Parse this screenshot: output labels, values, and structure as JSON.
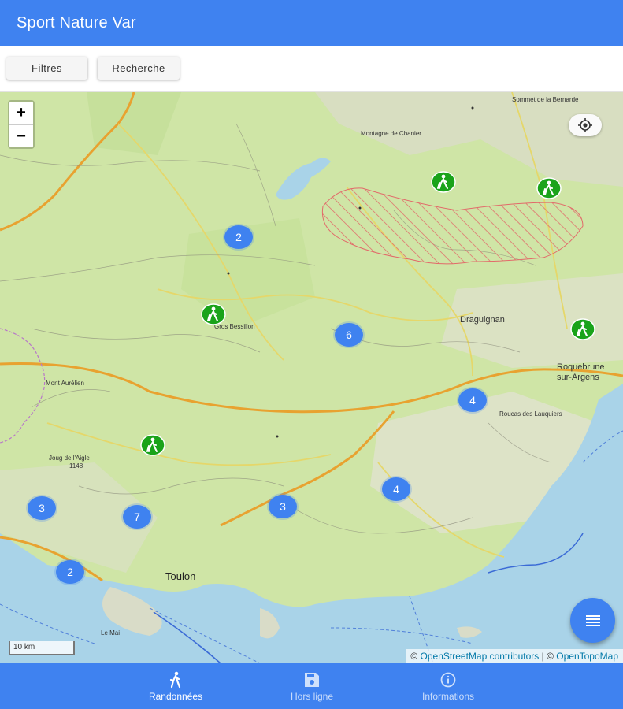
{
  "app": {
    "title": "Sport Nature Var"
  },
  "toolbar": {
    "filters_label": "Filtres",
    "search_label": "Recherche"
  },
  "map": {
    "zoom_in_label": "+",
    "zoom_out_label": "−",
    "scale_label": "10 km",
    "attribution": {
      "prefix": "© ",
      "osm": "OpenStreetMap contributors",
      "separator": " | © ",
      "topo": "OpenTopoMap"
    },
    "place_labels": {
      "draguignan": "Draguignan",
      "roquebrune_1": "Roquebrune",
      "roquebrune_2": "sur-Argens",
      "toulon": "Toulon",
      "gros_bessillon": "Gros Bessillon",
      "mont_aurelien": "Mont Aurélien",
      "joug_aigle": "Joug de l'Aigle",
      "joug_alt": "1148",
      "roucas": "Roucas des Lauquiers",
      "montagne_chanier": "Montagne de Chanier",
      "sommet_bernarde": "Sommet de la Bernarde",
      "le_mai": "Le Mai"
    },
    "clusters": [
      {
        "count": "2"
      },
      {
        "count": "6"
      },
      {
        "count": "4"
      },
      {
        "count": "4"
      },
      {
        "count": "3"
      },
      {
        "count": "7"
      },
      {
        "count": "3"
      },
      {
        "count": "2"
      }
    ],
    "poi_icon": "hiking-icon"
  },
  "nav": {
    "items": [
      {
        "label": "Randonnées",
        "icon": "hiking-icon",
        "active": true
      },
      {
        "label": "Hors ligne",
        "icon": "save-icon",
        "active": false
      },
      {
        "label": "Informations",
        "icon": "info-icon",
        "active": false
      }
    ]
  },
  "colors": {
    "primary": "#3f82f0",
    "poi_green": "#1aa31a",
    "sea": "#a9d3e8",
    "land": "#cfe5a6",
    "restricted_zone": "#e26a6a"
  }
}
